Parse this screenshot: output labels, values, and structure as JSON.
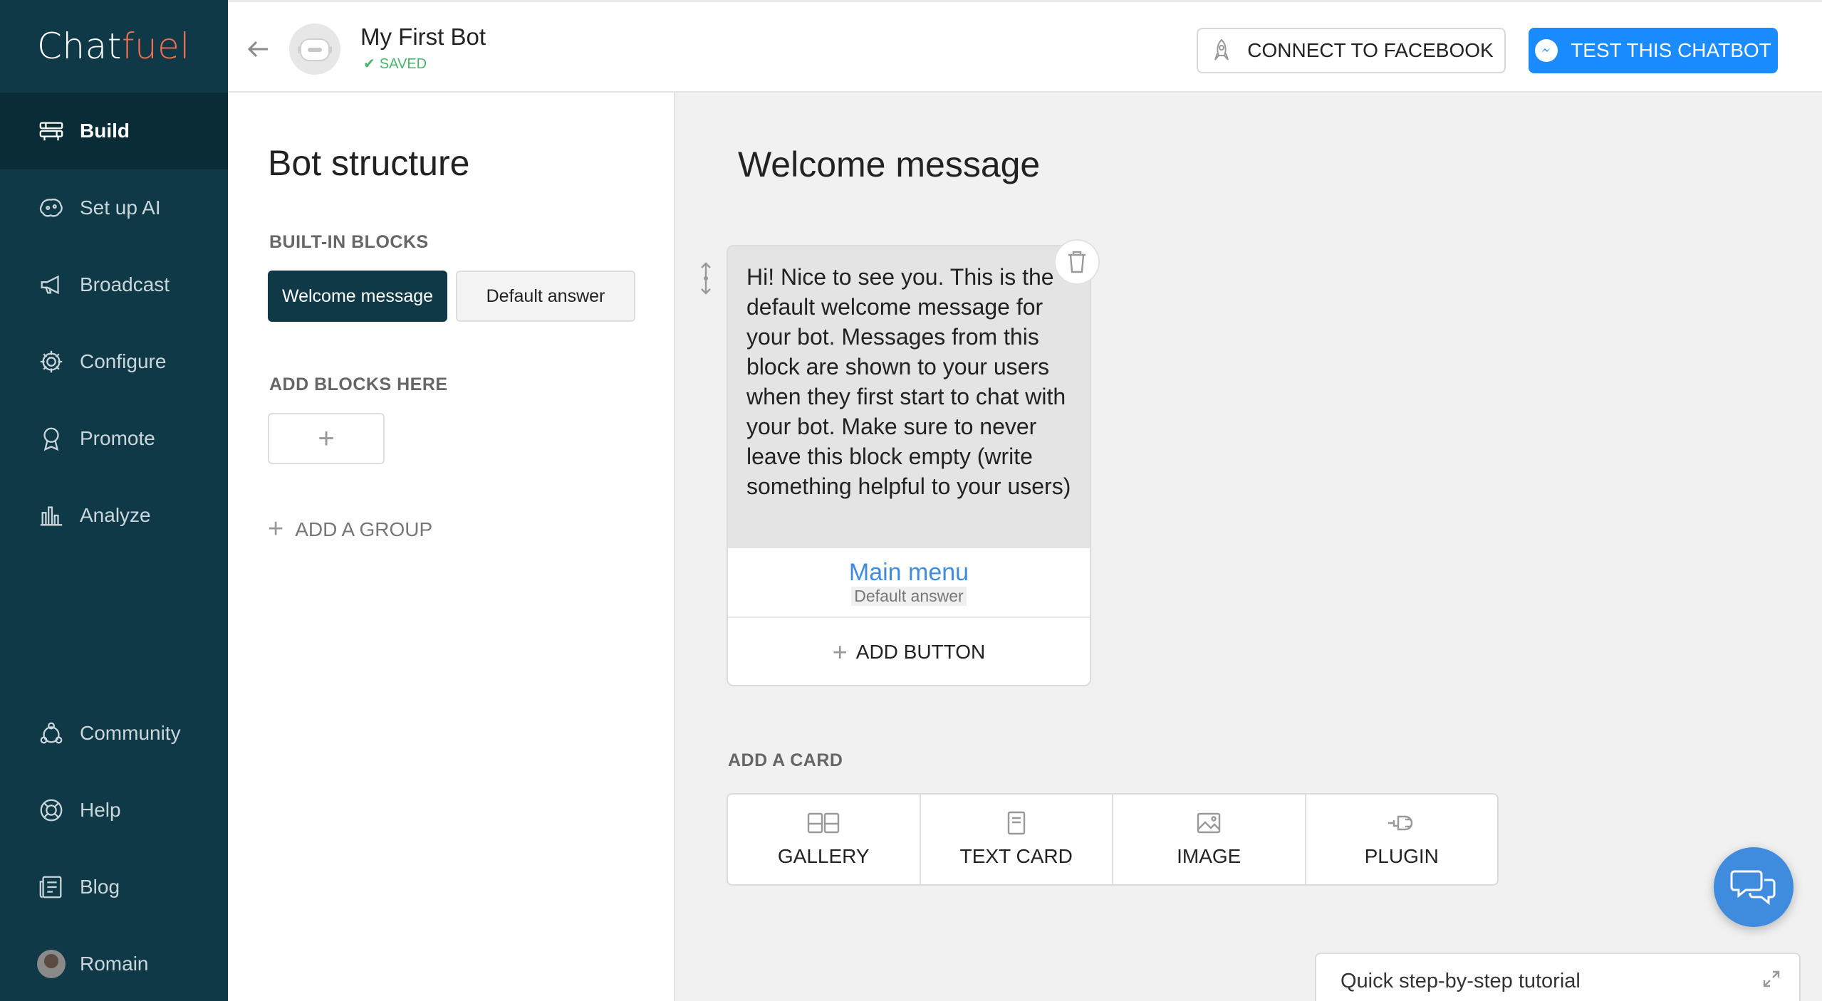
{
  "brand": {
    "logo_main": "Chat",
    "logo_accent": "fuel",
    "accent_color": "#f16d52",
    "sidebar_color": "#0f3946"
  },
  "sidebar": {
    "items": [
      {
        "label": "Build",
        "icon": "build-icon",
        "active": true
      },
      {
        "label": "Set up AI",
        "icon": "ai-icon"
      },
      {
        "label": "Broadcast",
        "icon": "megaphone-icon"
      },
      {
        "label": "Configure",
        "icon": "gear-icon"
      },
      {
        "label": "Promote",
        "icon": "badge-icon"
      },
      {
        "label": "Analyze",
        "icon": "chart-icon"
      }
    ],
    "bottom_items": [
      {
        "label": "Community",
        "icon": "community-icon"
      },
      {
        "label": "Help",
        "icon": "lifebuoy-icon"
      },
      {
        "label": "Blog",
        "icon": "blog-icon"
      },
      {
        "label": "Romain",
        "icon": "avatar"
      }
    ]
  },
  "header": {
    "bot_name": "My First Bot",
    "status": "SAVED",
    "connect_label": "CONNECT TO FACEBOOK",
    "test_label": "TEST THIS CHATBOT",
    "primary_color": "#1a8cff"
  },
  "structure": {
    "title": "Bot structure",
    "builtin_label": "BUILT-IN BLOCKS",
    "blocks": [
      "Welcome message",
      "Default answer"
    ],
    "add_blocks_label": "ADD BLOCKS HERE",
    "add_block_symbol": "+",
    "add_group_label": "ADD A GROUP"
  },
  "main": {
    "title": "Welcome message",
    "card_text": "Hi! Nice to see you. This is the default welcome message for your bot. Messages from this block are shown to your users when they first start to chat with your bot. Make sure to never leave this block empty (write something helpful to your users)",
    "button_title": "Main menu",
    "button_target": "Default answer",
    "add_button_label": "ADD BUTTON",
    "add_card_label": "ADD A CARD",
    "card_types": [
      {
        "label": "GALLERY",
        "icon": "gallery-icon"
      },
      {
        "label": "TEXT CARD",
        "icon": "text-card-icon"
      },
      {
        "label": "IMAGE",
        "icon": "image-icon"
      },
      {
        "label": "PLUGIN",
        "icon": "plugin-icon"
      }
    ]
  },
  "tutorial": {
    "label": "Quick step-by-step tutorial"
  }
}
